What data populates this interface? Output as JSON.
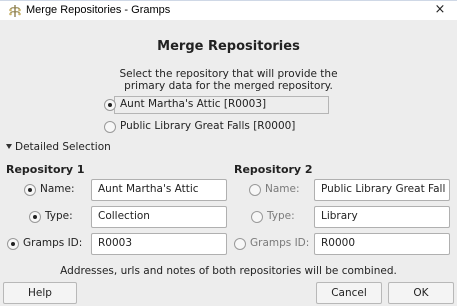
{
  "window": {
    "title": "Merge Repositories - Gramps",
    "close_glyph": "×"
  },
  "header": {
    "title": "Merge Repositories",
    "instructions_line1": "Select the repository that will provide the",
    "instructions_line2": "primary data for the merged repository."
  },
  "primary_options": [
    {
      "label": "Aunt Martha's Attic [R0003]",
      "selected": true
    },
    {
      "label": "Public Library Great Falls [R0000]",
      "selected": false
    }
  ],
  "detailed": {
    "expander_label": "Detailed Selection",
    "repo1": {
      "heading": "Repository 1",
      "name_label": "Name:",
      "name_value": "Aunt Martha's Attic",
      "type_label": "Type:",
      "type_value": "Collection",
      "id_label": "Gramps ID:",
      "id_value": "R0003"
    },
    "repo2": {
      "heading": "Repository 2",
      "name_label": "Name:",
      "name_value": "Public Library Great Fall",
      "type_label": "Type:",
      "type_value": "Library",
      "id_label": "Gramps ID:",
      "id_value": "R0000"
    }
  },
  "note": "Addresses, urls and notes of both repositories will be combined.",
  "buttons": {
    "help": "Help",
    "cancel": "Cancel",
    "ok": "OK"
  }
}
